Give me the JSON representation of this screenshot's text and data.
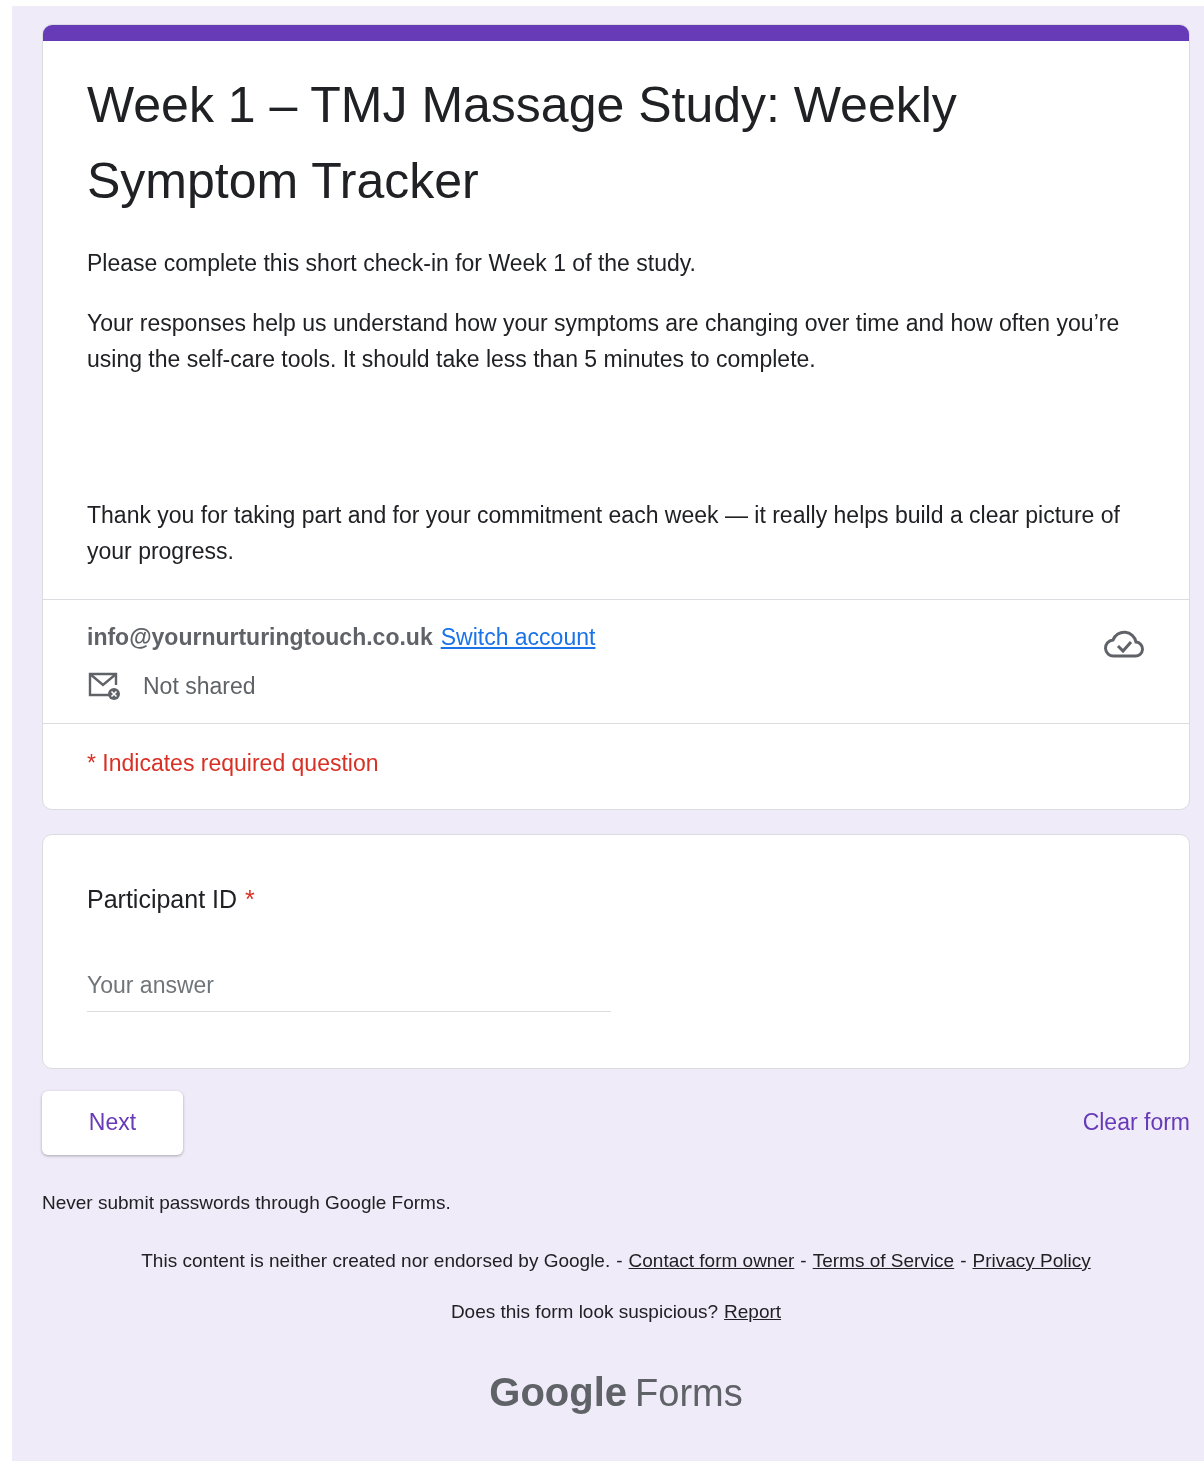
{
  "header": {
    "title": "Week 1 – TMJ Massage Study: Weekly Symptom Tracker",
    "paragraphs": [
      "Please complete this short check-in for Week 1 of the study.",
      "Your responses help us understand how your symptoms are changing over time and how often you’re using the self-care tools. It should take less than 5 minutes to complete.",
      "Thank you for taking part and for your commitment each week — it really helps build a clear picture of your progress."
    ],
    "account": {
      "email": "info@yournurturingtouch.co.uk",
      "switch_link": "Switch account",
      "sharing": "Not shared"
    },
    "required_note": {
      "mark": "*",
      "text": "Indicates required question"
    }
  },
  "questions": [
    {
      "label": "Participant ID",
      "required": true,
      "mark": "*",
      "placeholder": "Your answer"
    }
  ],
  "actions": {
    "next": "Next",
    "clear": "Clear form"
  },
  "footer": {
    "warning": "Never submit passwords through Google Forms.",
    "disclaimer": "This content is neither created nor endorsed by Google.",
    "separator": "-",
    "links": [
      "Contact form owner",
      "Terms of Service",
      "Privacy Policy"
    ],
    "suspicious": "Does this form look suspicious?",
    "report": "Report",
    "logo": {
      "brand": "Google",
      "product": "Forms"
    }
  }
}
